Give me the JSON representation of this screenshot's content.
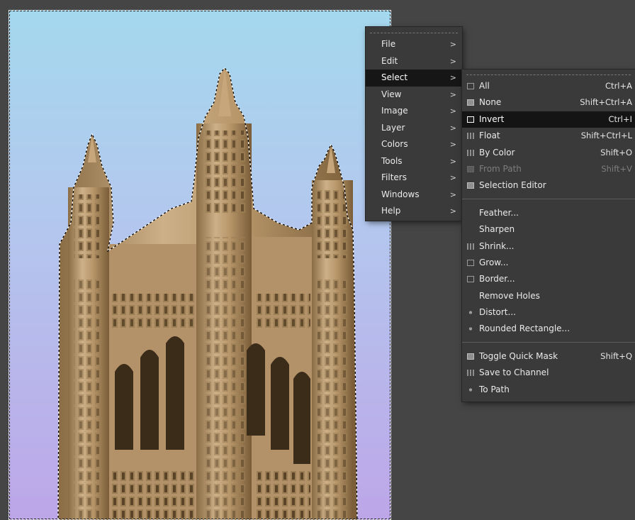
{
  "main_menu": {
    "items": [
      {
        "label": "File"
      },
      {
        "label": "Edit"
      },
      {
        "label": "Select",
        "active": true
      },
      {
        "label": "View"
      },
      {
        "label": "Image"
      },
      {
        "label": "Layer"
      },
      {
        "label": "Colors"
      },
      {
        "label": "Tools"
      },
      {
        "label": "Filters"
      },
      {
        "label": "Windows"
      },
      {
        "label": "Help"
      }
    ],
    "arrow_glyph": ">"
  },
  "select_menu": {
    "group1": [
      {
        "label": "All",
        "accel": "Ctrl+A",
        "icon": "select-all-icon"
      },
      {
        "label": "None",
        "accel": "Shift+Ctrl+A",
        "icon": "select-none-icon"
      },
      {
        "label": "Invert",
        "accel": "Ctrl+I",
        "icon": "invert-selection-icon",
        "active": true
      },
      {
        "label": "Float",
        "accel": "Shift+Ctrl+L",
        "icon": "float-icon"
      },
      {
        "label": "By Color",
        "accel": "Shift+O",
        "icon": "by-color-icon"
      },
      {
        "label": "From Path",
        "accel": "Shift+V",
        "icon": "from-path-icon",
        "disabled": true
      },
      {
        "label": "Selection Editor",
        "accel": "",
        "icon": "selection-editor-icon"
      }
    ],
    "group2": [
      {
        "label": "Feather...",
        "icon": ""
      },
      {
        "label": "Sharpen",
        "icon": ""
      },
      {
        "label": "Shrink...",
        "icon": "shrink-icon"
      },
      {
        "label": "Grow...",
        "icon": "grow-icon"
      },
      {
        "label": "Border...",
        "icon": "border-icon"
      },
      {
        "label": "Remove Holes",
        "icon": ""
      },
      {
        "label": "Distort...",
        "icon": "distort-icon"
      },
      {
        "label": "Rounded Rectangle...",
        "icon": "rounded-rectangle-icon"
      }
    ],
    "group3": [
      {
        "label": "Toggle Quick Mask",
        "accel": "Shift+Q",
        "icon": "quick-mask-icon"
      },
      {
        "label": "Save to Channel",
        "accel": "",
        "icon": "save-channel-icon"
      },
      {
        "label": "To Path",
        "accel": "",
        "icon": "to-path-icon"
      }
    ]
  },
  "colors": {
    "background": "#454545",
    "menu_bg": "#3a3a3a",
    "highlight": "#141414",
    "sky_top": "#a4d8ee",
    "sky_bottom": "#bda6e8",
    "stone": "#c2a57a"
  }
}
